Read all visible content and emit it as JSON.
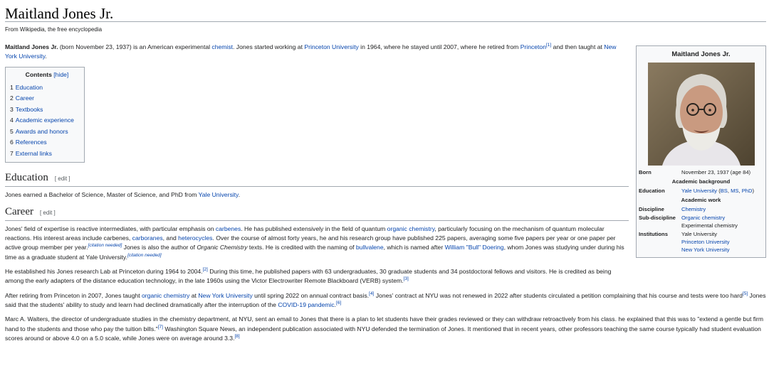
{
  "page": {
    "title": "Maitland Jones Jr.",
    "tagline": "From Wikipedia, the free encyclopedia"
  },
  "lead": {
    "name": "Maitland Jones Jr.",
    "t1": " (born November 23, 1937) is an American experimental ",
    "l_chemist": "chemist",
    "t2": ". Jones started working at ",
    "l_princeton_univ": "Princeton University",
    "t3": " in 1964, where he stayed until 2007, where he retired from ",
    "l_princeton": "Princeton",
    "ref1": "[1]",
    "t4": " and then taught at ",
    "l_nyu": "New York University",
    "t5": "."
  },
  "toc": {
    "title": "Contents",
    "hide": "[hide]",
    "items": [
      {
        "num": "1",
        "label": "Education"
      },
      {
        "num": "2",
        "label": "Career"
      },
      {
        "num": "3",
        "label": "Textbooks"
      },
      {
        "num": "4",
        "label": "Academic experience"
      },
      {
        "num": "5",
        "label": "Awards and honors"
      },
      {
        "num": "6",
        "label": "References"
      },
      {
        "num": "7",
        "label": "External links"
      }
    ]
  },
  "education": {
    "heading": "Education",
    "edit": "[ edit ]",
    "t1": "Jones earned a Bachelor of Science, Master of Science, and PhD from ",
    "l_yale": "Yale University",
    "t2": "."
  },
  "career": {
    "heading": "Career",
    "edit": "[ edit ]",
    "p1": {
      "t1": "Jones' field of expertise is reactive intermediates, with particular emphasis on ",
      "l_carbenes": "carbenes",
      "t2": ". He has published extensively in the field of quantum ",
      "l_organic": "organic chemistry",
      "t3": ", particularly focusing on the mechanism of quantum molecular reactions. His interest areas include carbenes, ",
      "l_carboranes": "carboranes",
      "t4": ", and ",
      "l_heterocycles": "heterocycles",
      "t5": ". Over the course of almost forty years, he and his research group have published 225 papers, averaging some five papers per year or one paper per active group member per year.",
      "cn1": "[citation needed]",
      "t6": " Jones is also the author of ",
      "italic": "Organic Chemistry",
      "t7": " texts. He is credited with the naming of ",
      "l_bullvalene": "bullvalene",
      "t8": ", which is named after ",
      "l_doering": "William \"Bull\" Doering",
      "t9": ", whom Jones was studying under during his time as a graduate student at Yale University.",
      "cn2": "[citation needed]"
    },
    "p2": {
      "t1": "He established his Jones research Lab at Princeton during 1964 to 2004.",
      "ref2": "[2]",
      "t2": " During this time, he published papers with 63 undergraduates, 30 graduate students and 34 postdoctoral fellows and visitors. He is credited as being among the early adapters of the distance education technology, in the late 1960s using the Victor Electrowriter Remote Blackboard (VERB) system.",
      "ref3": "[3]"
    },
    "p3": {
      "t1": "After retiring from Princeton in 2007, Jones taught ",
      "l_organic": "organic chemistry",
      "t2": " at ",
      "l_nyu": "New York University",
      "t3": " until spring 2022 on annual contract basis.",
      "ref4": "[4]",
      "t4": " Jones' contract at NYU was not renewed in 2022 after students circulated a petition complaining that his course and tests were too hard",
      "ref5": "[5]",
      "t5": " Jones said that the students' ability to study and learn had declined dramatically after the interruption of the ",
      "l_covid": "COVID-19 pandemic",
      "t6": ".",
      "ref6": "[6]"
    },
    "p4": {
      "t1": "Marc A. Walters, the director of undergraduate studies in the chemistry department, at NYU, sent an email to Jones that there is a plan to let students have their grades reviewed or they can withdraw retroactively from his class. he explained that this was to \"extend a gentle but firm hand to the students and those who pay the tuition bills.\"",
      "ref7": "[7]",
      "t2": " Washington Square News, an independent publication associated with NYU defended the termination of Jones. It mentioned that in recent years, other professors teaching the same course typically had student evaluation scores around or above 4.0 on a 5.0 scale, while Jones were on average around 3.3.",
      "ref8": "[8]"
    }
  },
  "infobox": {
    "title": "Maitland Jones Jr.",
    "born_label": "Born",
    "born_value": "November 23, 1937 (age 84)",
    "academic_background": "Academic background",
    "education_label": "Education",
    "edu_yale": "Yale University",
    "edu_open": " (",
    "edu_bs": "BS",
    "edu_c1": ", ",
    "edu_ms": "MS",
    "edu_c2": ", ",
    "edu_phd": "PhD",
    "edu_close": ")",
    "academic_work": "Academic work",
    "discipline_label": "Discipline",
    "discipline_value": "Chemistry",
    "subdiscipline_label": "Sub-discipline",
    "subdiscipline_1": "Organic chemistry",
    "subdiscipline_2": "Experimental chemistry",
    "institutions_label": "Institutions",
    "inst_1": "Yale University",
    "inst_2": "Princeton University",
    "inst_3": "New York University"
  }
}
